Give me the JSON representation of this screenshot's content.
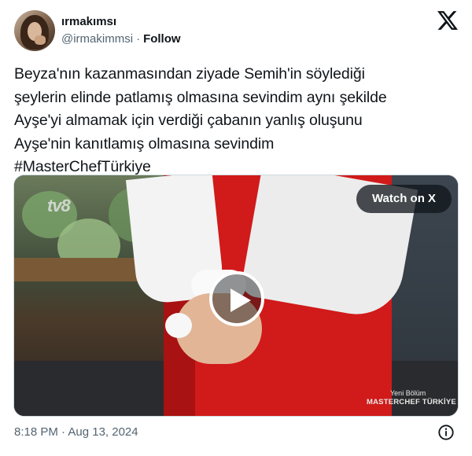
{
  "user": {
    "display_name": "ırmakımsı",
    "handle": "@irmakimmsi",
    "separator": "·",
    "follow_label": "Follow"
  },
  "tweet": {
    "text": "Beyza'nın kazanmasından ziyade Semih'in söylediği\nşeylerin elinde patlamış olmasına sevindim aynı şekilde\nAyşe'yi almamak için verdiği çabanın yanlış oluşunu\nAyşe'nin kanıtlamış olmasına sevindim\n#MasterChefTürkiye"
  },
  "media": {
    "watch_label": "Watch on X",
    "channel_logo": "tv8",
    "watermark_episode": "Yeni Bölüm",
    "watermark_show": "MASTERCHEF TÜRKİYE"
  },
  "footer": {
    "timestamp": "8:18 PM · Aug 13, 2024"
  },
  "icons": {
    "brand": "x-logo-icon",
    "play": "play-icon",
    "info": "info-icon"
  }
}
